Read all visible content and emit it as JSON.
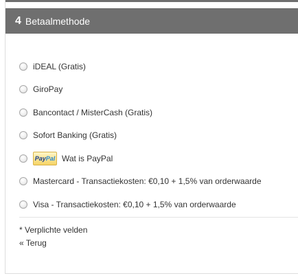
{
  "step": {
    "number": "4",
    "title": "Betaalmethode"
  },
  "payment_methods": [
    {
      "label": "iDEAL (Gratis)",
      "selected": false
    },
    {
      "label": "GiroPay",
      "selected": false
    },
    {
      "label": "Bancontact / MisterCash (Gratis)",
      "selected": false
    },
    {
      "label": "Sofort Banking (Gratis)",
      "selected": false
    },
    {
      "label": "Wat is PayPal",
      "selected": false,
      "logo": {
        "part1": "Pay",
        "part2": "Pal"
      }
    },
    {
      "label": "Mastercard - Transactiekosten: €0,10 + 1,5% van orderwaarde",
      "selected": false
    },
    {
      "label": "Visa - Transactiekosten: €0,10 + 1,5% van orderwaarde",
      "selected": false
    }
  ],
  "footer": {
    "required_note": "* Verplichte velden",
    "back_link": "« Terug"
  },
  "colors": {
    "header_bg": "#6f6f6f",
    "header_text": "#ffffff",
    "text": "#333333"
  }
}
